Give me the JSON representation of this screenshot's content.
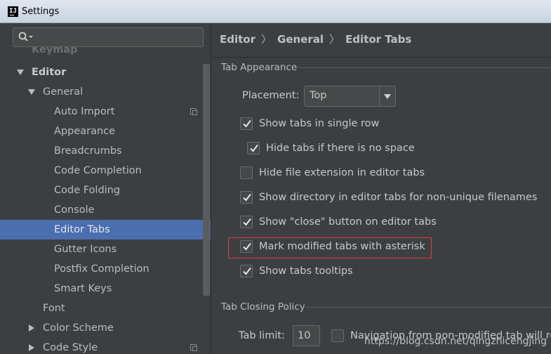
{
  "window": {
    "title": "Settings",
    "app_icon": "IJ"
  },
  "search": {
    "placeholder": ""
  },
  "tree": {
    "items": [
      {
        "label": "Keymap"
      },
      {
        "label": "Editor"
      },
      {
        "label": "General"
      },
      {
        "label": "Auto Import"
      },
      {
        "label": "Appearance"
      },
      {
        "label": "Breadcrumbs"
      },
      {
        "label": "Code Completion"
      },
      {
        "label": "Code Folding"
      },
      {
        "label": "Console"
      },
      {
        "label": "Editor Tabs"
      },
      {
        "label": "Gutter Icons"
      },
      {
        "label": "Postfix Completion"
      },
      {
        "label": "Smart Keys"
      },
      {
        "label": "Font"
      },
      {
        "label": "Color Scheme"
      },
      {
        "label": "Code Style"
      }
    ]
  },
  "breadcrumb": {
    "part1": "Editor",
    "part2": "General",
    "part3": "Editor Tabs",
    "separator": "〉"
  },
  "tab_appearance": {
    "title": "Tab Appearance",
    "placement_label": "Placement:",
    "placement_value": "Top",
    "options": [
      {
        "label": "Show tabs in single row",
        "checked": true
      },
      {
        "label": "Hide tabs if there is no space",
        "checked": true
      },
      {
        "label": "Hide file extension in editor tabs",
        "checked": false
      },
      {
        "label": "Show directory in editor tabs for non-unique filenames",
        "checked": true
      },
      {
        "label": "Show \"close\" button on editor tabs",
        "checked": true
      },
      {
        "label": "Mark modified tabs with asterisk",
        "checked": true
      },
      {
        "label": "Show tabs tooltips",
        "checked": true
      }
    ]
  },
  "tab_closing": {
    "title": "Tab Closing Policy",
    "tab_limit_label": "Tab limit:",
    "tab_limit_value": "10",
    "navigation_label": "Navigation from non-modified tab will reu",
    "navigation_checked": false
  },
  "watermark": "https://blog.csdn.net/qingzhicengjing",
  "colors": {
    "selection": "#4b6eaf",
    "highlight_border": "#e0383c",
    "background": "#3c3f41"
  }
}
